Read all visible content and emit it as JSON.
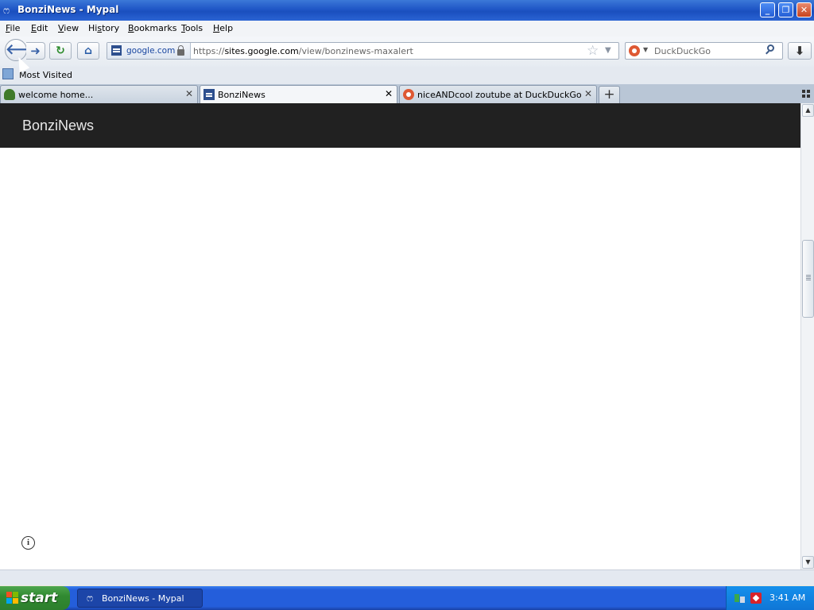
{
  "window": {
    "title": "BonziNews - Mypal",
    "buttons": {
      "minimize": "_",
      "maximize": "❐",
      "close": "✕"
    }
  },
  "menubar": {
    "items": [
      {
        "pre": "",
        "key": "F",
        "post": "ile"
      },
      {
        "pre": "",
        "key": "E",
        "post": "dit"
      },
      {
        "pre": "",
        "key": "V",
        "post": "iew"
      },
      {
        "pre": "Hi",
        "key": "s",
        "post": "tory"
      },
      {
        "pre": "",
        "key": "B",
        "post": "ookmarks"
      },
      {
        "pre": "",
        "key": "T",
        "post": "ools"
      },
      {
        "pre": "",
        "key": "H",
        "post": "elp"
      }
    ]
  },
  "navbar": {
    "back_glyph": "🡐",
    "forward_glyph": "➜",
    "reload_glyph": "↻",
    "home_glyph": "⌂",
    "identity": "google.com",
    "url_prefix": "https://",
    "url_host": "sites.google.com",
    "url_path": "/view/bonzinews-maxalert",
    "search_placeholder": "DuckDuckGo",
    "search_engine_drop": "▼",
    "download_glyph": "⬇"
  },
  "bookmarks": {
    "most_visited": "Most Visited"
  },
  "tabs": [
    {
      "title": "welcome home...",
      "favicon": "tree-icon",
      "active": false
    },
    {
      "title": "BonziNews",
      "favicon": "google-sites-icon",
      "active": true
    },
    {
      "title": "niceANDcool zoutube at DuckDuckGo",
      "favicon": "duckduckgo-icon",
      "active": false
    }
  ],
  "tab_close": "✕",
  "newtab_glyph": "+",
  "page": {
    "site_title": "BonziNews",
    "info_glyph": "i"
  },
  "scrollbar": {
    "up": "▲",
    "down": "▼",
    "position": 0.34
  },
  "taskbar": {
    "start_label": "start",
    "task_label": "BonziNews - Mypal",
    "clock": "3:41 AM"
  },
  "colors": {
    "site_header": "#212121",
    "titlebar": "#1f56c6",
    "start_button": "#318a31"
  }
}
